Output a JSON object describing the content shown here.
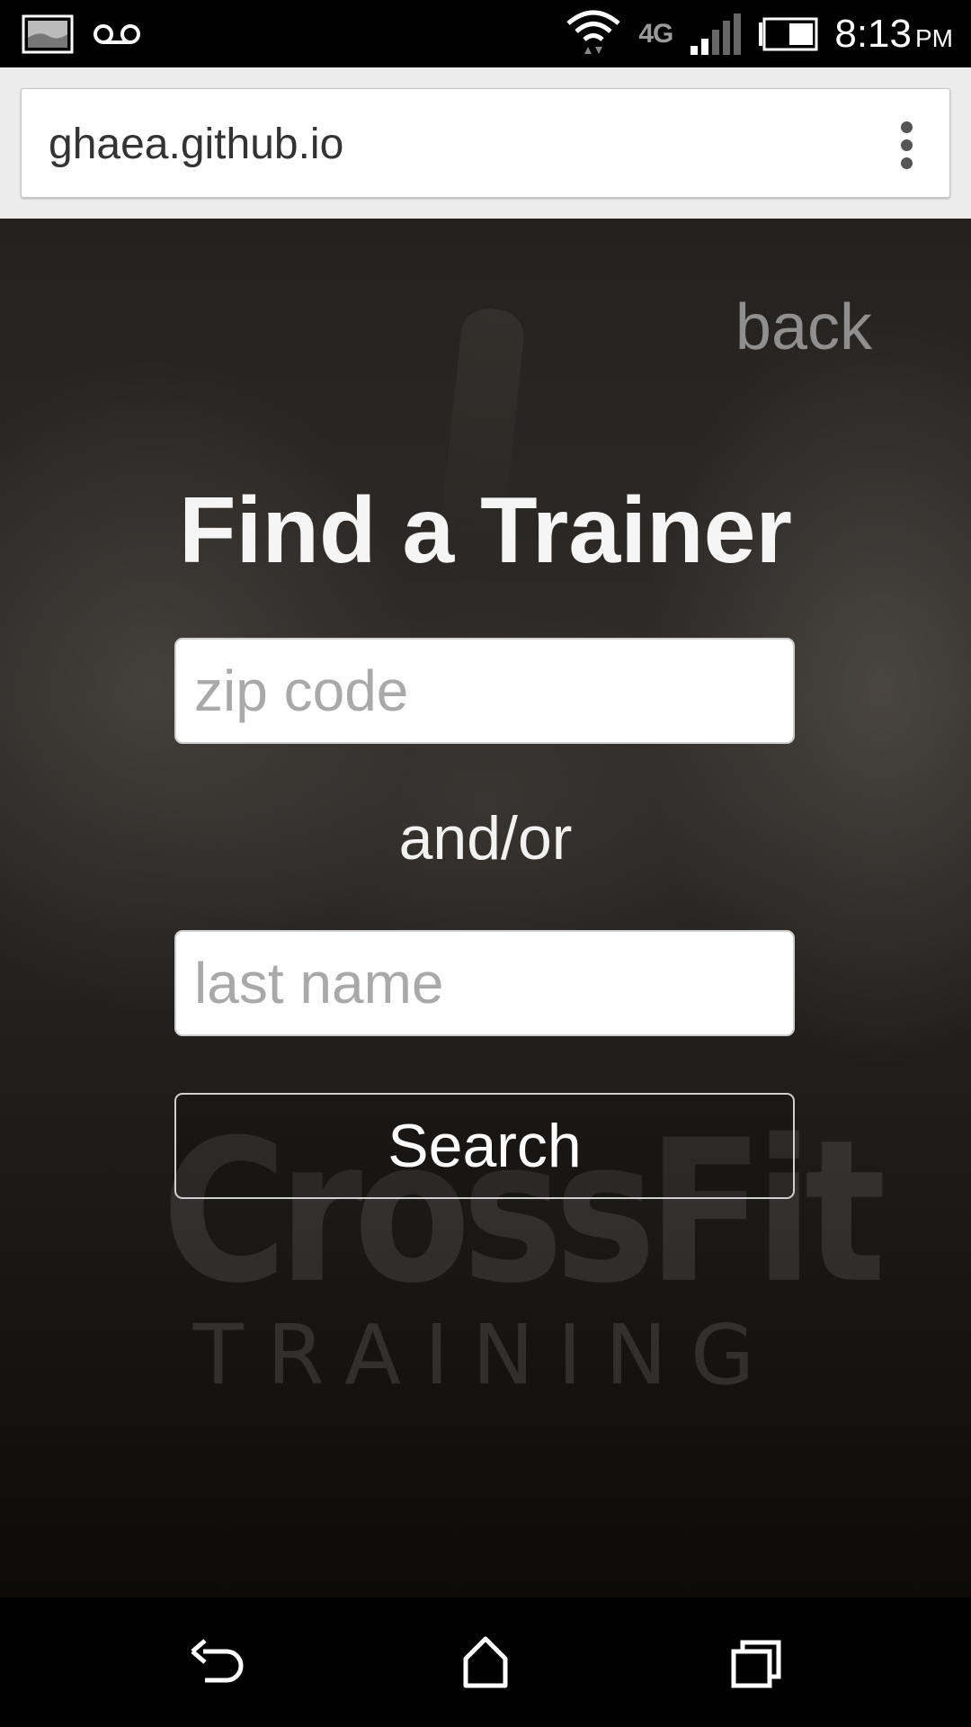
{
  "status_bar": {
    "time": "8:13",
    "ampm": "PM",
    "network": "4G",
    "icons": [
      "gallery-icon",
      "voicemail-icon",
      "wifi-icon",
      "lte-icon",
      "signal-icon",
      "battery-icon"
    ]
  },
  "browser": {
    "url": "ghaea.github.io",
    "menu_icon": "overflow-menu-icon"
  },
  "page": {
    "back_label": "back",
    "title": "Find a Trainer",
    "zip_placeholder": "zip code",
    "separator": "and/or",
    "last_name_placeholder": "last name",
    "search_label": "Search",
    "bg_logo_main": "CrossFit",
    "bg_logo_sub": "TRAINING"
  },
  "nav_bar": {
    "icons": [
      "back-nav-icon",
      "home-nav-icon",
      "recent-apps-icon"
    ]
  },
  "colors": {
    "title": "#f5f5f5",
    "back_link": "#8f8f8f",
    "placeholder": "#a9a9a9"
  }
}
